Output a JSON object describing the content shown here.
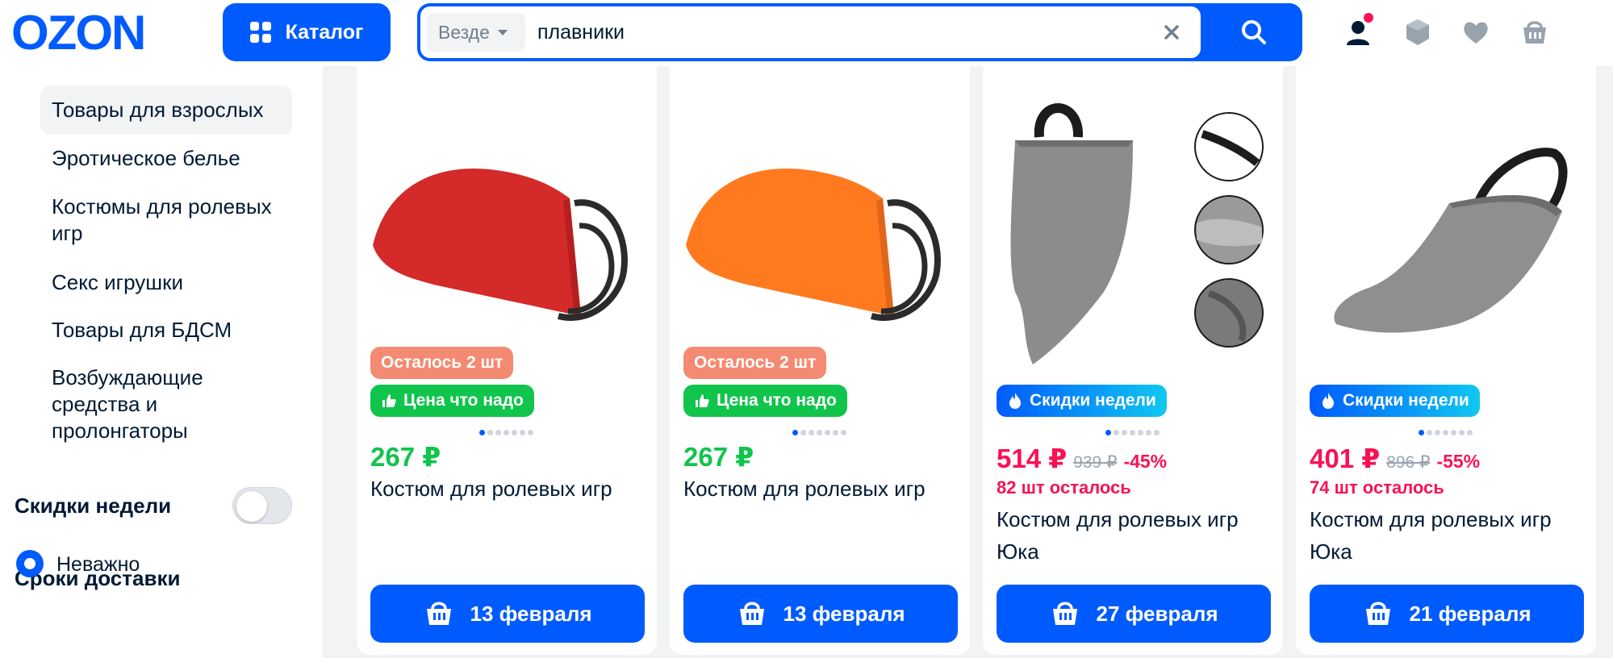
{
  "header": {
    "logo_text": "OZON",
    "catalog_label": "Каталог",
    "search_scope": "Везде",
    "search_value": "плавники",
    "colors": {
      "brand": "#005bff",
      "accent": "#f91155"
    }
  },
  "sidebar": {
    "categories": [
      {
        "label": "Товары для взрослых",
        "active": true
      },
      {
        "label": "Эротическое белье"
      },
      {
        "label": "Костюмы для ролевых игр"
      },
      {
        "label": "Секс игрушки"
      },
      {
        "label": "Товары для БДСМ"
      },
      {
        "label": "Возбуждающие средства и пролонгаторы"
      }
    ],
    "weekly_discount_label": "Скидки недели",
    "weekly_discount_toggle": false,
    "delivery_label": "Сроки доставки",
    "delivery_option": "Неважно"
  },
  "products": [
    {
      "image": "red-fin-costume",
      "badges": [
        "Осталось 2 шт",
        "Цена что надо"
      ],
      "price": "267 ₽",
      "title": "Костюм для ролевых игр",
      "delivery": "13 февраля",
      "image_index": 1,
      "image_count": 7
    },
    {
      "image": "orange-fin-costume",
      "badges": [
        "Осталось 2 шт",
        "Цена что надо"
      ],
      "price": "267 ₽",
      "title": "Костюм для ролевых игр",
      "delivery": "13 февраля",
      "image_index": 1,
      "image_count": 7
    },
    {
      "image": "grey-fin-costume-details",
      "badges": [
        "Скидки недели"
      ],
      "price": "514 ₽",
      "old_price": "939 ₽",
      "discount": "-45%",
      "stock": "82 шт осталось",
      "title": "Костюм для ролевых игр Юка",
      "delivery": "27 февраля",
      "image_index": 1,
      "image_count": 7
    },
    {
      "image": "grey-fin-costume",
      "badges": [
        "Скидки недели"
      ],
      "price": "401 ₽",
      "old_price": "896 ₽",
      "discount": "-55%",
      "stock": "74 шт осталось",
      "title": "Костюм для ролевых игр Юка",
      "delivery": "21 февраля",
      "image_index": 1,
      "image_count": 7
    }
  ]
}
